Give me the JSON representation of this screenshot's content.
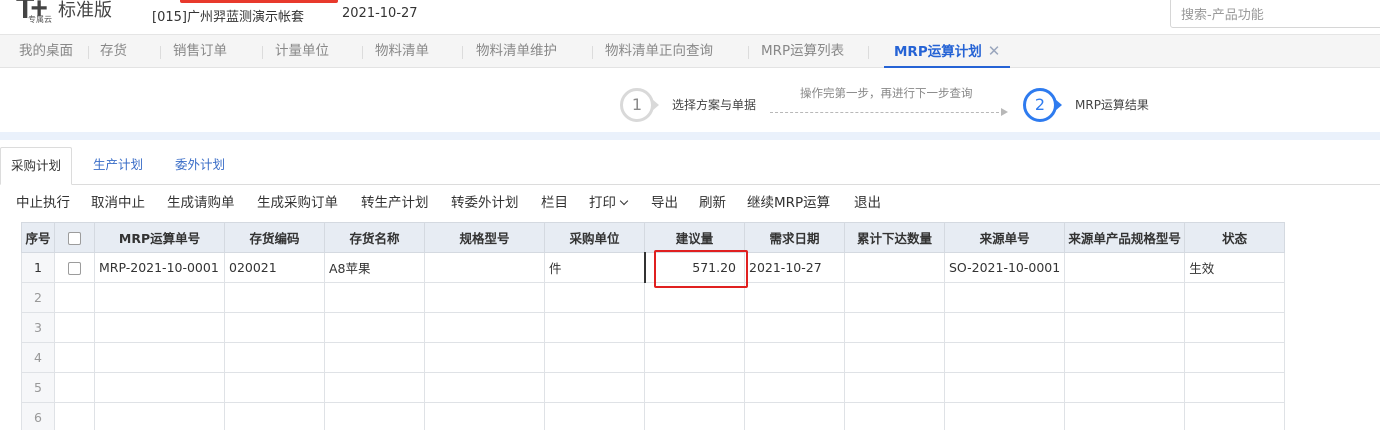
{
  "header": {
    "logo_mark": "T+",
    "logo_sub": "专属云",
    "logo_text": "标准版",
    "account": "[015]广州羿蓝测演示帐套",
    "date": "2021-10-27",
    "search_placeholder": "搜索-产品功能"
  },
  "nav": {
    "tabs": [
      "我的桌面",
      "存货",
      "销售订单",
      "计量单位",
      "物料清单",
      "物料清单维护",
      "物料清单正向查询",
      "MRP运算列表",
      "MRP运算计划"
    ],
    "active_tab": "MRP运算计划",
    "close_glyph": "✕"
  },
  "steps": {
    "step1_number": "1",
    "step1_label": "选择方案与单据",
    "hint": "操作完第一步，再进行下一步查询",
    "step2_number": "2",
    "step2_label": "MRP运算结果"
  },
  "subtabs": {
    "items": [
      "采购计划",
      "生产计划",
      "委外计划"
    ],
    "active": "采购计划"
  },
  "toolbar": {
    "items": [
      "中止执行",
      "取消中止",
      "生成请购单",
      "生成采购订单",
      "转生产计划",
      "转委外计划",
      "栏目",
      "打印",
      "导出",
      "刷新",
      "继续MRP运算",
      "退出"
    ]
  },
  "grid": {
    "columns": [
      "序号",
      "",
      "MRP运算单号",
      "存货编码",
      "存货名称",
      "规格型号",
      "采购单位",
      "建议量",
      "需求日期",
      "累计下达数量",
      "来源单号",
      "来源单产品规格型号",
      "状态"
    ],
    "rows": [
      {
        "no": "1",
        "mrp_no": "MRP-2021-10-0001",
        "inv_code": "020021",
        "inv_name": "A8苹果",
        "spec": "",
        "unit": "件",
        "qty": "571.20",
        "date": "2021-10-27",
        "issued": "",
        "src_no": "SO-2021-10-0001",
        "src_spec": "",
        "status": "生效"
      },
      {
        "no": "2"
      },
      {
        "no": "3"
      },
      {
        "no": "4"
      },
      {
        "no": "5"
      },
      {
        "no": "6"
      }
    ]
  },
  "colors": {
    "accent": "#2563d5",
    "step_active": "#2e7bef",
    "highlight_box": "#e02020"
  }
}
